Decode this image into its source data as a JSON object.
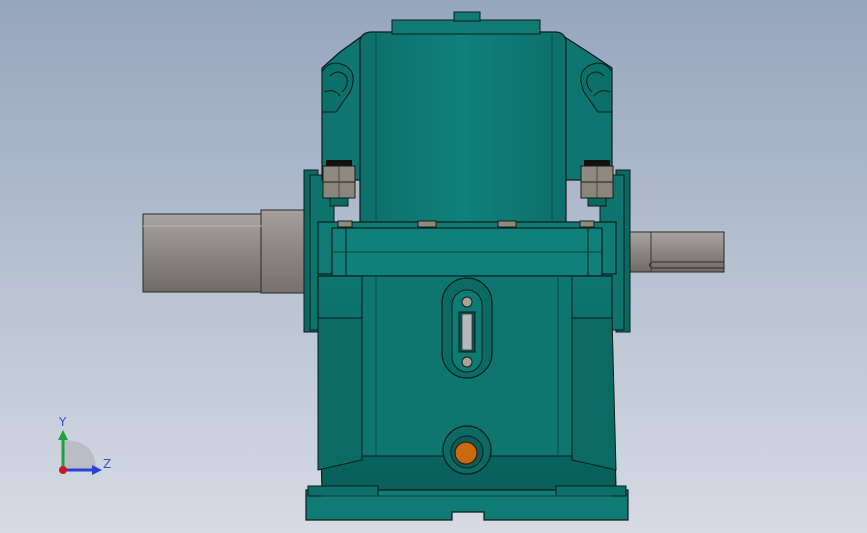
{
  "viewport": {
    "background_top": "#96a6bd",
    "background_bottom": "#d6dbe4"
  },
  "gearbox": {
    "housing_color": "#0f7b74",
    "housing_dark": "#0a5d58",
    "housing_light": "#17918a",
    "edge_color": "#0b1d1c",
    "shaft_color": "#8c8983",
    "shaft_light": "#a7a49e",
    "bolt_color": "#8e8a80",
    "drain_plug_color": "#c86a12"
  },
  "triad": {
    "y_label": "Y",
    "z_label": "Z",
    "y_color": "#1aa43b",
    "z_color": "#2b41d6",
    "origin_color": "#c21b1b"
  }
}
